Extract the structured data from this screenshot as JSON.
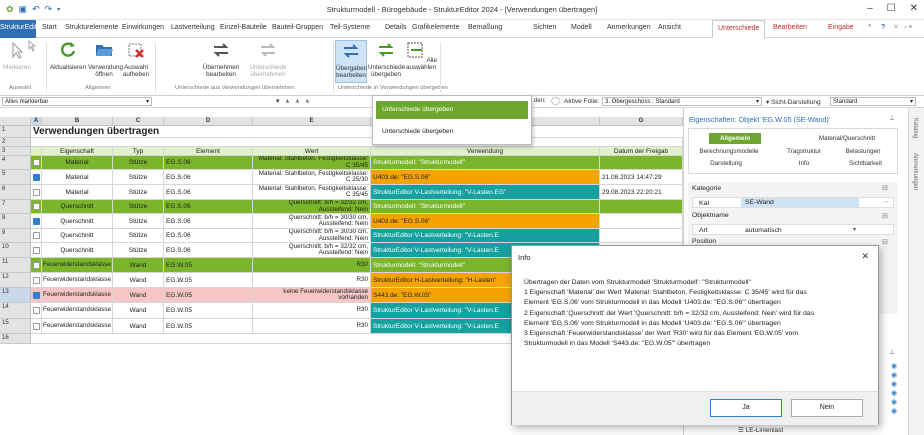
{
  "titlebar": {
    "title": "Strukturmodell - Bürogebäude - StrukturEditor 2024 - [Verwendungen übertragen]"
  },
  "tabs": {
    "file": "StrukturEditor",
    "items": [
      "Start",
      "Strukturelemente",
      "Einwirkungen",
      "Lastverteilung",
      "Einzel-Bauteile",
      "Bauteil-Gruppen",
      "Teil-Systeme",
      "Details",
      "Grafikelemente",
      "Bemaßung",
      "Sichten",
      "Modell",
      "Anmerkungen",
      "Ansicht"
    ],
    "active": "Unterschiede",
    "extra": [
      "Bearbeiten",
      "Eingabe"
    ],
    "help": "?"
  },
  "ribbon": {
    "markieren": "Markieren",
    "markieren2": "Markieren",
    "aktualisieren": "Aktualisieren",
    "verwendung_oeffnen": "Verwendung öffnen",
    "auswahl_aufheben": "Auswahl aufheben",
    "uebernehmen_bearbeiten": "Übernehmen bearbeiten",
    "unterschiede_uebernehmen": "Unterschiede übernehmen",
    "uebergaben_bearbeiten": "Übergaben bearbeiten",
    "unterschiede_uebergeben": "Unterschiede übergeben",
    "alle_auswaehlen": "Alle auswählen",
    "group_auswahl": "Auswahl",
    "group_allgemein": "Allgemein",
    "group_uebernehmen": "Unterschiede aus Verwendungen übernehmen",
    "group_uebergeben": "Unterschiede in Verwendungen übergeben"
  },
  "filterbar": {
    "select_all": "Alles markierbar",
    "folie_label": "den:",
    "aktive_folie": "Aktive Folie:",
    "aktive_folie_value": "3. Obergeschoss : Standard",
    "sicht_label": "Sicht-Darstellung",
    "sicht_value": "Standard"
  },
  "dropdown": {
    "items": [
      "Unterschiede übergeben",
      "Unterschiede übergeben"
    ]
  },
  "sheet": {
    "title": "Verwendungen übertragen",
    "col_letters": [
      "A",
      "B",
      "C",
      "D",
      "E",
      "",
      "G"
    ],
    "headers": [
      "Eigenschaft",
      "Typ",
      "Element",
      "Wert",
      "Verwendung",
      "Datum der Freigab"
    ],
    "row_numbers": [
      "1",
      "2",
      "3",
      "4",
      "5",
      "6",
      "7",
      "8",
      "9",
      "10",
      "11",
      "12",
      "13",
      "14",
      "15",
      "16"
    ],
    "rows": [
      {
        "checked": false,
        "eig": "Material",
        "typ": "Stütze",
        "el": "EG.S.06",
        "wert": "Material: Stahlbeton, Festigkeitsklasse: C 35/45",
        "verw": "Strukturmodell: \"Strukturmodell\"",
        "datum": ""
      },
      {
        "checked": true,
        "eig": "Material",
        "typ": "Stütze",
        "el": "EG.S.06",
        "wert": "Material: Stahlbeton, Festigkeitsklasse: C 25/30",
        "verw": "U403.de: \"EG.S.06\"",
        "datum": "21.08.2023 14:47:29"
      },
      {
        "checked": false,
        "eig": "Material",
        "typ": "Stütze",
        "el": "EG.S.06",
        "wert": "Material: Stahlbeton, Festigkeitsklasse: C 35/45",
        "verw": "StrukturEditor V-Lastverteilung: \"V-Lasten.EG\"",
        "datum": "29.08.2023 22:20:21"
      },
      {
        "checked": false,
        "eig": "Querschnitt",
        "typ": "Stütze",
        "el": "EG.S.06",
        "wert": "Querschnitt: b/h = 32/32 cm, Aussteifend: Nein",
        "verw": "Strukturmodell: \"Strukturmodell\"",
        "datum": ""
      },
      {
        "checked": true,
        "eig": "Querschnitt",
        "typ": "Stütze",
        "el": "EG.S.06",
        "wert": "Querschnitt: b/h = 30/30 cm, Aussteifend: Nein",
        "verw": "U403.de: \"EG.S.06\"",
        "datum": ""
      },
      {
        "checked": false,
        "eig": "Querschnitt",
        "typ": "Stütze",
        "el": "EG.S.06",
        "wert": "Querschnitt: b/h = 30/30 cm, Aussteifend: Nein",
        "verw": "StrukturEditor V-Lastverteilung: \"V-Lasten.E",
        "datum": ""
      },
      {
        "checked": false,
        "eig": "Querschnitt",
        "typ": "Stütze",
        "el": "EG.S.06",
        "wert": "Querschnitt: b/h = 32/32 cm, Aussteifend: Nein",
        "verw": "StrukturEditor V-Lastverteilung: \"V-Lasten.E",
        "datum": ""
      },
      {
        "checked": false,
        "eig": "Feuerwiderstandsklasse",
        "typ": "Wand",
        "el": "EG.W.05",
        "wert": "R30",
        "verw": "Strukturmodell: \"Strukturmodell\"",
        "datum": ""
      },
      {
        "checked": false,
        "eig": "Feuerwiderstandsklasse",
        "typ": "Wand",
        "el": "EG.W.05",
        "wert": "R30",
        "verw": "StrukturEditor H-Lastverteilung: \"H-Lasten\"",
        "datum": ""
      },
      {
        "checked": true,
        "eig": "Feuerwiderstandsklasse",
        "typ": "Wand",
        "el": "EG.W.05",
        "wert": "keine Feuerwiderstandsklasse vorhanden",
        "verw": "S443.de: \"EG.W.05\"",
        "datum": ""
      },
      {
        "checked": false,
        "eig": "Feuerwiderstandsklasse",
        "typ": "Wand",
        "el": "EG.W.05",
        "wert": "R30",
        "verw": "StrukturEditor V-Lastverteilung: \"V-Lasten.E",
        "datum": ""
      },
      {
        "checked": false,
        "eig": "Feuerwiderstandsklasse",
        "typ": "Wand",
        "el": "EG.W.05",
        "wert": "R30",
        "verw": "StrukturEditor V-Lastverteilung: \"V-Lasten.E",
        "datum": ""
      }
    ]
  },
  "props": {
    "title": "Eigenschaften: Objekt 'EG.W.05 (SE-Wand)'",
    "tabs": [
      "Allgemein",
      "Material/Querschnitt",
      "Berechnungsmodelle",
      "Tragstruktur",
      "Belastungen",
      "Darstellung",
      "Info",
      "Sichtbarkeit"
    ],
    "sec_kategorie": "Kategorie",
    "kat_label": "Kat",
    "kat_value": "SE-Wand",
    "sec_objektname": "Objektname",
    "art_label": "Art",
    "art_value": "automatisch",
    "sec_position": "Position",
    "layer_item": "LE-Linienlast"
  },
  "sidetabs": [
    "Katalog",
    "Anmerkungen"
  ],
  "dialog": {
    "title": "Info",
    "lines": [
      "Übertragen der Daten vom Strukturmodell 'Strukturmodell': \"Strukturmodell\"",
      "1 Eigenschaft 'Material' der Wert 'Material: Stahlbeton, Festigkeitsklasse: C 35/45' wird für das",
      "Element 'EG.S.06' vom Strukturmodell in das Modell 'U403.de: \"EG.S.06\"' übertragen",
      "2 Eigenschaft 'Querschnitt' der Wert 'Querschnitt: b/h = 32/32 cm, Aussteifend: Nein' wird für das",
      "Element 'EG.S.06' vom Strukturmodell in das Modell 'U403.de: \"EG.S.06\"' übertragen",
      "3 Eigenschaft 'Feuerwiderstandsklasse' der Wert 'R30' wird für das Element 'EG.W.05' vom",
      "Strukturmodell in das Modell 'S443.de: \"EG.W.05\"' übertragen"
    ],
    "yes": "Ja",
    "no": "Nein"
  },
  "colors": {
    "accent": "#2f6fb6",
    "green": "#7ab52b",
    "green_light": "#e1f0cf",
    "orange": "#f4a300",
    "teal": "#16a0a0",
    "pink": "#f6c6c6",
    "active_tab": "#b83030"
  }
}
